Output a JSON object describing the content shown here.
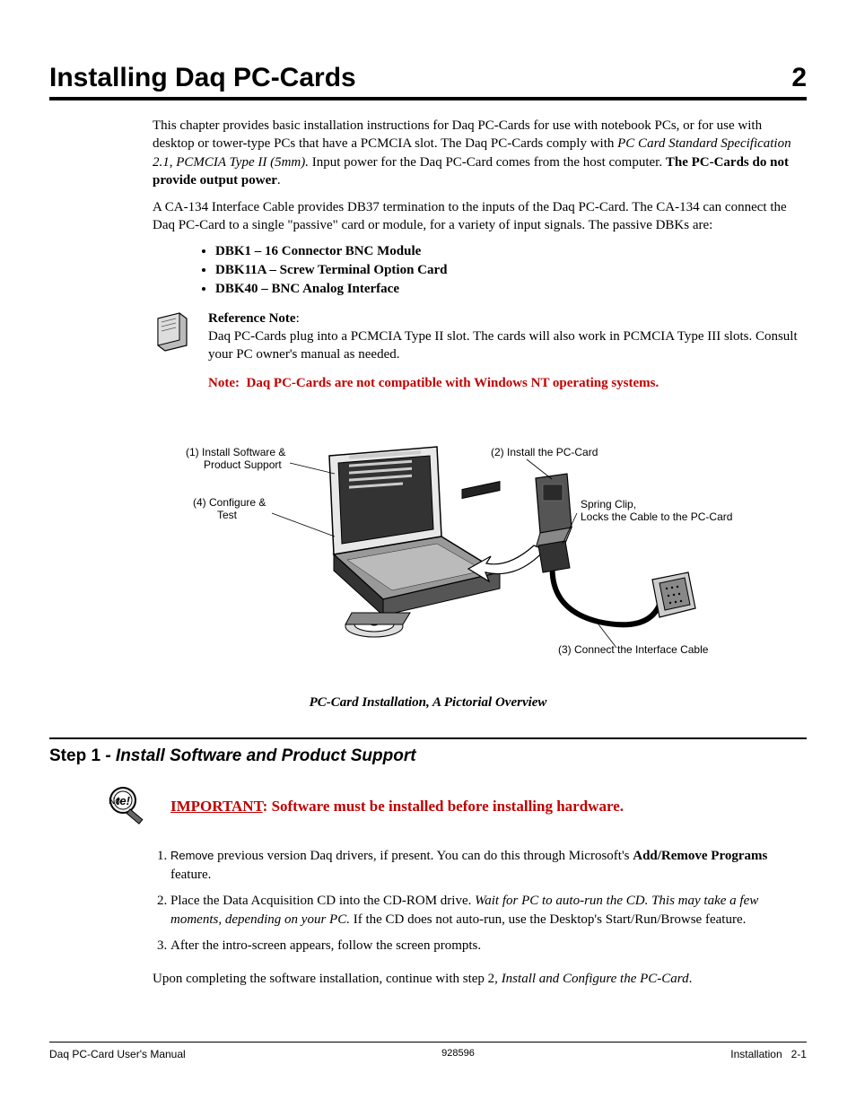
{
  "header": {
    "title": "Installing Daq PC-Cards",
    "chapter_number": "2"
  },
  "intro": {
    "p1_a": "This chapter provides basic installation instructions for Daq PC-Cards for use with notebook PCs, or for use with desktop or tower-type PCs that have a PCMCIA slot.  The Daq PC-Cards comply with ",
    "p1_italic": "PC Card Standard Specification 2.1, PCMCIA Type II (5mm).",
    "p1_b": "  Input power for the Daq PC-Card comes from the host computer.  ",
    "p1_bold": "The PC-Cards do not provide output power",
    "p1_c": ".",
    "p2": "A CA-134 Interface Cable provides DB37 termination to the inputs of the Daq PC-Card.  The CA-134 can connect the Daq PC-Card to a single \"passive\" card or module, for a variety of input signals.  The passive DBKs are:",
    "bullets": [
      "DBK1 – 16 Connector BNC Module",
      "DBK11A – Screw Terminal Option Card",
      "DBK40 – BNC Analog Interface"
    ]
  },
  "refnote": {
    "label": "Reference Note",
    "text": "Daq PC-Cards plug into a PCMCIA Type II slot.  The cards will also work in PCMCIA Type III slots.  Consult your PC owner's manual as needed."
  },
  "rednote": {
    "label": "Note",
    "text": "Daq PC-Cards are not compatible with Windows NT operating systems."
  },
  "figure": {
    "callout1a": "(1) Install Software &",
    "callout1b": "Product Support",
    "callout2": "(2) Install the PC-Card",
    "callout3": "(3) Connect the Interface Cable",
    "callout4a": "(4) Configure &",
    "callout4b": "Test",
    "spring_a": "Spring Clip,",
    "spring_b": "Locks the Cable to the PC-Card",
    "caption": "PC-Card Installation, A Pictorial Overview"
  },
  "step1": {
    "prefix": "Step 1 ",
    "title": "- Install Software and Product Support",
    "important_label": "IMPORTANT",
    "important_text": ":  Software must be installed before installing hardware.",
    "li1_a": "Remove",
    "li1_b": " previous version Daq drivers, if present.  You can do this through Microsoft's ",
    "li1_bold": "Add/Remove Programs",
    "li1_c": " feature.",
    "li2_a": "Place the Data Acquisition CD into the CD-ROM drive. ",
    "li2_italic": "Wait for PC to auto-run the CD.  This may take a few moments, depending on your PC.",
    "li2_b": "  If the CD does not auto-run, use the Desktop's Start/Run/Browse feature.",
    "li3": "After the intro-screen appears, follow the screen prompts.",
    "closing_a": "Upon completing the software installation, continue with step 2, ",
    "closing_italic": "Install and Configure the PC-Card",
    "closing_b": "."
  },
  "footer": {
    "left": "Daq PC-Card User's Manual",
    "center": "928596",
    "right_label": "Installation",
    "right_page": "2-1"
  }
}
